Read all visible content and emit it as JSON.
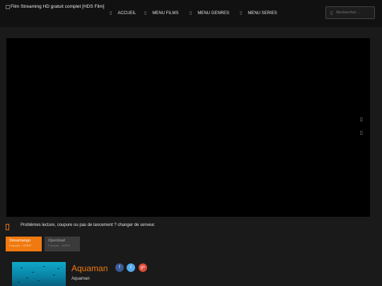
{
  "site": {
    "logo_alt": "Film Streaming HD gratuit complet [HDS Film]"
  },
  "nav": {
    "items": [
      {
        "label": "ACCUEIL",
        "icon": "home-icon"
      },
      {
        "label": "MENU FILMS",
        "icon": "film-icon"
      },
      {
        "label": "MENU GENRES",
        "icon": "genres-icon"
      },
      {
        "label": "MENU SERIES",
        "icon": "series-icon"
      }
    ]
  },
  "search": {
    "placeholder": "Rechercher ..."
  },
  "player": {
    "controls": [
      "expand-icon",
      "light-icon"
    ]
  },
  "notice": {
    "text": "Problèmes lecture, coupure ou pas de lancement ? changer de serveur."
  },
  "servers": [
    {
      "name": "Streamango",
      "quality": "Français - HDRIP",
      "active": true
    },
    {
      "name": "Openload",
      "quality": "Français - HDRIP",
      "active": false
    }
  ],
  "movie": {
    "title": "Aquaman",
    "original_title": "Aquaman"
  },
  "share": [
    {
      "network": "facebook",
      "glyph": "f",
      "color": "#3b5998"
    },
    {
      "network": "twitter",
      "glyph": "t",
      "color": "#55acee"
    },
    {
      "network": "google-plus",
      "glyph": "g+",
      "color": "#dd4b39"
    }
  ],
  "colors": {
    "accent": "#f07a10",
    "header_bg": "#111111",
    "page_bg": "#1a1a1a"
  }
}
